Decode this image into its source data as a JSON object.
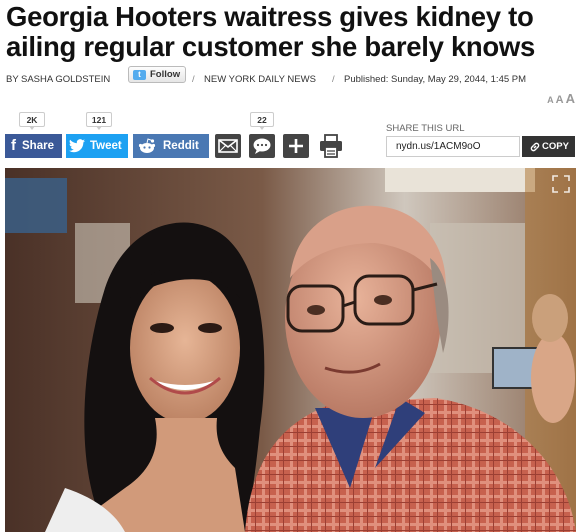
{
  "article": {
    "headline": "Georgia Hooters waitress gives kidney to ailing regular customer she barely knows",
    "byline_prefix": "BY",
    "author": "SASHA GOLDSTEIN",
    "follow_label": "Follow",
    "separator": "/",
    "publication": "NEW YORK DAILY NEWS",
    "published": "Published: Sunday, May 29, 2044, 1:45 PM",
    "text_size": [
      "A",
      "A",
      "A"
    ]
  },
  "share": {
    "facebook": {
      "count": "2K",
      "label": "Share"
    },
    "twitter": {
      "count": "121",
      "label": "Tweet"
    },
    "reddit": {
      "label": "Reddit"
    },
    "comments": {
      "count": "22"
    },
    "url_label": "SHARE THIS URL",
    "url_value": "nydn.us/1ACM9oO",
    "copy_label": "COPY"
  },
  "photo": {
    "expand_icon": "expand-icon"
  },
  "colors": {
    "facebook": "#3b5998",
    "twitter": "#1da1f2",
    "reddit": "#4a78b3",
    "dark_button": "#444444"
  }
}
